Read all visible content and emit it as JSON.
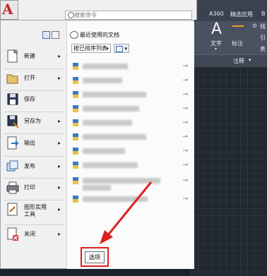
{
  "ribbon": {
    "tabs": [
      "A360",
      "精选应用",
      "B"
    ],
    "text_button": "文字",
    "dim_button": "标注",
    "panel_label": "注释",
    "side_items": [
      "线",
      "引",
      "表"
    ]
  },
  "search": {
    "placeholder": "搜索命令"
  },
  "recent": {
    "title": "最近使用的文档",
    "sort_label": "按已排序列表",
    "files": [
      "",
      "",
      "",
      "",
      "",
      "",
      "",
      "",
      "",
      "",
      ""
    ]
  },
  "commands": [
    {
      "label": "新建",
      "icon": "new-icon",
      "has_submenu": true
    },
    {
      "label": "打开",
      "icon": "open-folder-icon",
      "has_submenu": true
    },
    {
      "label": "保存",
      "icon": "save-icon",
      "has_submenu": false
    },
    {
      "label": "另存为",
      "icon": "save-as-icon",
      "has_submenu": true
    },
    {
      "label": "输出",
      "icon": "export-icon",
      "has_submenu": true
    },
    {
      "label": "发布",
      "icon": "publish-icon",
      "has_submenu": true
    },
    {
      "label": "打印",
      "icon": "print-icon",
      "has_submenu": true
    },
    {
      "label": "图形实用工具",
      "icon": "drawing-utilities-icon",
      "has_submenu": true
    },
    {
      "label": "关闭",
      "icon": "close-drawing-icon",
      "has_submenu": true
    }
  ],
  "options_button": "选项",
  "colors": {
    "accent": "#c0282e",
    "highlight": "#e02020"
  }
}
